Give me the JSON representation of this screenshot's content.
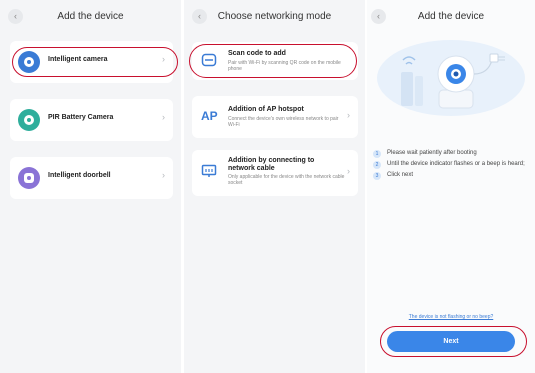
{
  "panel1": {
    "title": "Add the device",
    "items": [
      {
        "label": "Intelligent camera",
        "icon": "camera-icon",
        "color": "#3a7bd5"
      },
      {
        "label": "PIR Battery Camera",
        "icon": "battery-camera-icon",
        "color": "#2fae9c"
      },
      {
        "label": "Intelligent doorbell",
        "icon": "doorbell-icon",
        "color": "#8a73d6"
      }
    ]
  },
  "panel2": {
    "title": "Choose networking mode",
    "items": [
      {
        "title": "Scan code to add",
        "desc": "Pair with Wi-Fi by scanning QR code on the mobile phone",
        "icon": "scan-icon"
      },
      {
        "title": "Addition of AP hotspot",
        "desc": "Connect the device's own wireless network to pair Wi-Fi",
        "icon_text": "AP",
        "icon": "ap-icon"
      },
      {
        "title": "Addition by connecting to network cable",
        "desc": "Only applicable for the device with the network cable socket",
        "icon": "ethernet-icon"
      }
    ]
  },
  "panel3": {
    "title": "Add the device",
    "steps": [
      {
        "num": "1",
        "text": "Please wait patiently after booting"
      },
      {
        "num": "2",
        "text": "Until the device indicator flashes or a beep is heard;"
      },
      {
        "num": "3",
        "text": "Click next"
      }
    ],
    "help_link": "The device is not flashing or no beep?",
    "next_label": "Next"
  },
  "colors": {
    "accent": "#3a86e8",
    "highlight": "#c8102e"
  },
  "chevron": "›",
  "back": "‹"
}
